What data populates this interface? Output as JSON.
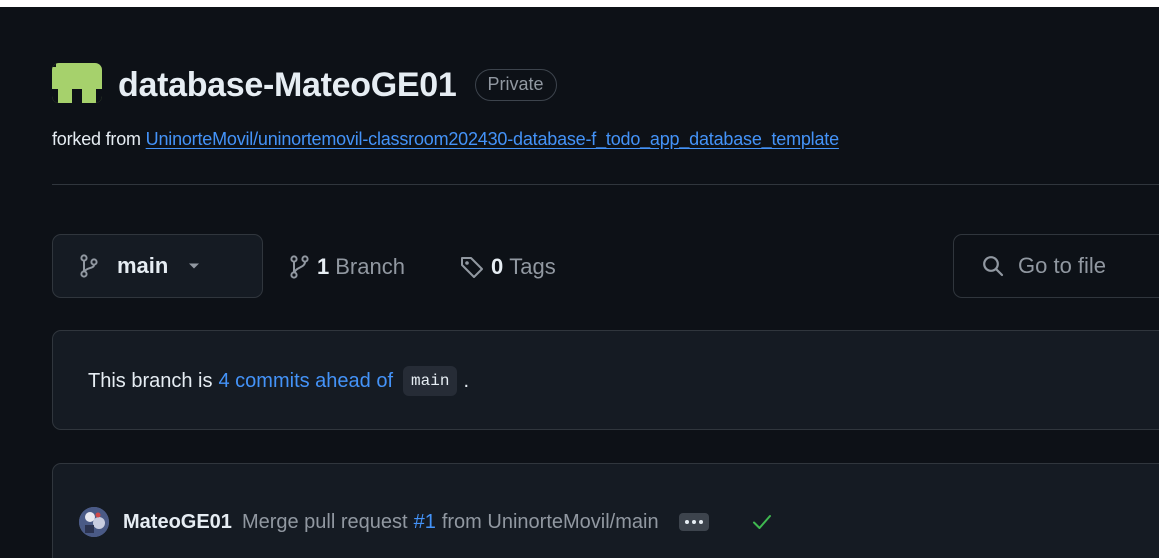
{
  "repo": {
    "name": "database-MateoGE01",
    "visibility": "Private",
    "forked_prefix": "forked from",
    "forked_from": "UninorteMovil/uninortemovil-classroom202430-database-f_todo_app_database_template"
  },
  "toolbar": {
    "branch_name": "main",
    "branch_count": "1",
    "branch_word": "Branch",
    "tag_count": "0",
    "tag_word": "Tags",
    "search_placeholder": "Go to file"
  },
  "ahead": {
    "prefix": "This branch is",
    "link_text": "4 commits ahead of",
    "base_branch": "main",
    "suffix": "."
  },
  "commit": {
    "author": "MateoGE01",
    "message_before": "Merge pull request",
    "pr_number": "#1",
    "message_after": "from UninorteMovil/main",
    "status": "success"
  },
  "colors": {
    "background": "#0d1117",
    "accent_link": "#4493f8",
    "success": "#3fb950"
  }
}
